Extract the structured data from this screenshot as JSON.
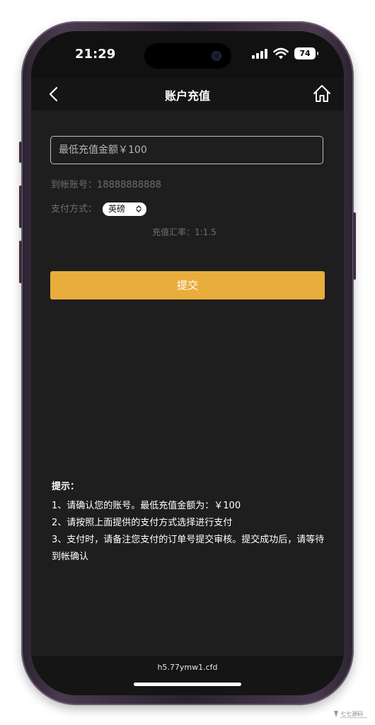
{
  "status": {
    "time": "21:29",
    "battery": "74"
  },
  "nav": {
    "title": "账户充值",
    "back_icon": "chevron-left-icon",
    "home_icon": "home-icon"
  },
  "form": {
    "amount_placeholder": "最低充值金额￥100",
    "account": "到帐账号：18888888888",
    "pay_label": "支付方式：",
    "pay_selected": "英磅",
    "rate": "充值汇率：1:1.5",
    "submit_label": "提交"
  },
  "tips": {
    "title": "提示：",
    "lines": [
      "1、请确认您的账号。最低充值金额为：￥100",
      "2、请按照上面提供的支付方式选择进行支付",
      "3、支付时，请备注您支付的订单号提交审核。提交成功后，请等待到帐确认"
    ]
  },
  "footer": {
    "domain": "h5.77ymw1.cfd"
  },
  "colors": {
    "accent": "#e9ad3c",
    "page_bg": "#1e1e1e",
    "bar_bg": "#151515"
  }
}
